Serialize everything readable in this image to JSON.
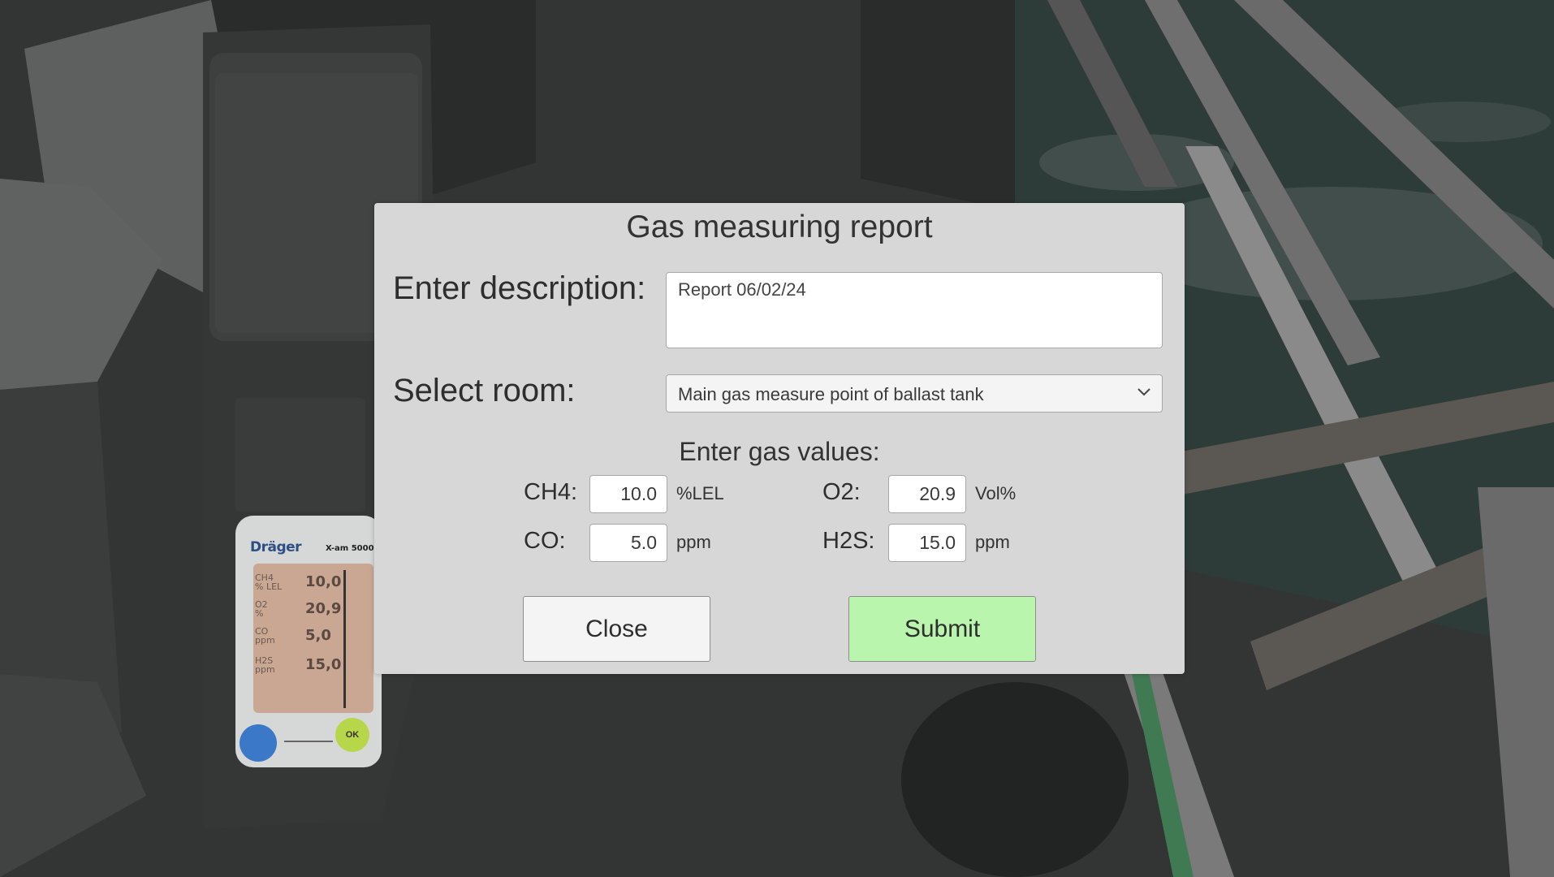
{
  "dialog": {
    "title": "Gas measuring report",
    "description_label": "Enter description:",
    "description_value": "Report 06/02/24",
    "room_label": "Select room:",
    "room_selected": "Main gas measure point of ballast tank",
    "gas_values_title": "Enter gas values:",
    "gases": {
      "ch4": {
        "label": "CH4:",
        "value": "10.0",
        "unit": "%LEL"
      },
      "o2": {
        "label": "O2:",
        "value": "20.9",
        "unit": "Vol%"
      },
      "co": {
        "label": "CO:",
        "value": "5.0",
        "unit": "ppm"
      },
      "h2s": {
        "label": "H2S:",
        "value": "15.0",
        "unit": "ppm"
      }
    },
    "close_label": "Close",
    "submit_label": "Submit"
  },
  "device": {
    "brand": "Dräger",
    "model": "X-am 5000",
    "readings": [
      {
        "label": "CH4\n% LEL",
        "value": "10,0"
      },
      {
        "label": "O2\n%",
        "value": "20,9"
      },
      {
        "label": "CO\nppm",
        "value": "5,0"
      },
      {
        "label": "H2S\nppm",
        "value": "15,0"
      }
    ],
    "ok_label": "OK"
  },
  "colors": {
    "dialog_bg": "#d7d7d7",
    "submit_bg": "#b9f5ad",
    "close_bg": "#f4f4f4",
    "device_screen": "#c9a793",
    "device_brand": "#2c4f86"
  }
}
